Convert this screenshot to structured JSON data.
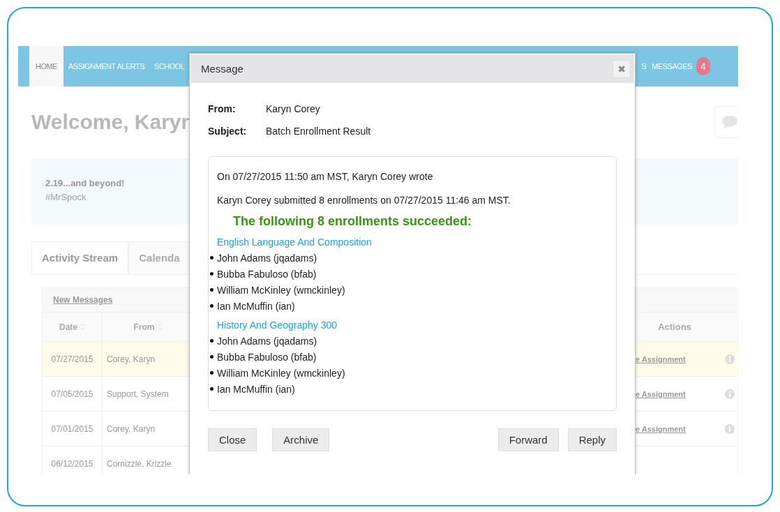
{
  "nav": {
    "items": [
      {
        "label": "HOME",
        "selected": true
      },
      {
        "label": "ASSIGNMENT ALERTS",
        "selected": false
      },
      {
        "label": "SCHOOL",
        "selected": false
      }
    ],
    "right_items": [
      {
        "label": "S",
        "selected": false
      },
      {
        "label": "MESSAGES",
        "selected": false,
        "badge": "4"
      }
    ]
  },
  "welcome": "Welcome, Karyn",
  "announcement": {
    "title": "2.19...and beyond!",
    "text": "#MrSpock"
  },
  "tabs": [
    {
      "label": "Activity Stream",
      "selected": true
    },
    {
      "label": "Calenda",
      "selected": false
    }
  ],
  "table": {
    "title": "New Messages",
    "columns": [
      "Date",
      "From",
      "Actions"
    ],
    "rows": [
      {
        "date": "07/27/2015",
        "from": "Corey, Karyn",
        "action": "e Assignment",
        "highlighted": true
      },
      {
        "date": "07/05/2015",
        "from": "Support, System",
        "action": "e Assignment",
        "highlighted": false
      },
      {
        "date": "07/01/2015",
        "from": "Corey, Karyn",
        "action": "e Assignment",
        "highlighted": false
      },
      {
        "date": "06/12/2015",
        "from": "Cornizzle, Krizzle",
        "highlighted": false
      }
    ]
  },
  "modal": {
    "title": "Message",
    "close": "✖",
    "fields": [
      {
        "label": "From:",
        "value": "Karyn Corey"
      },
      {
        "label": "Subject:",
        "value": "Batch Enrollment Result"
      }
    ],
    "intro": "On 07/27/2015 11:50 am MST, Karyn Corey wrote",
    "summary": "Karyn Corey submitted 8 enrollments on 07/27/2015 11:46 am MST.",
    "heading": "The following 8 enrollments succeeded:",
    "courses": [
      {
        "name": "English Language And Composition",
        "students": [
          "John Adams (jqadams)",
          "Bubba Fabuloso (bfab)",
          "William McKinley (wmckinley)",
          "Ian McMuffin (ian)"
        ]
      },
      {
        "name": "History And Geography 300",
        "students": [
          "John Adams (jqadams)",
          "Bubba Fabuloso (bfab)",
          "William McKinley (wmckinley)",
          "Ian McMuffin (ian)"
        ]
      }
    ],
    "left_buttons": [
      "Close",
      "Archive"
    ],
    "right_buttons": [
      "Forward",
      "Reply"
    ]
  }
}
